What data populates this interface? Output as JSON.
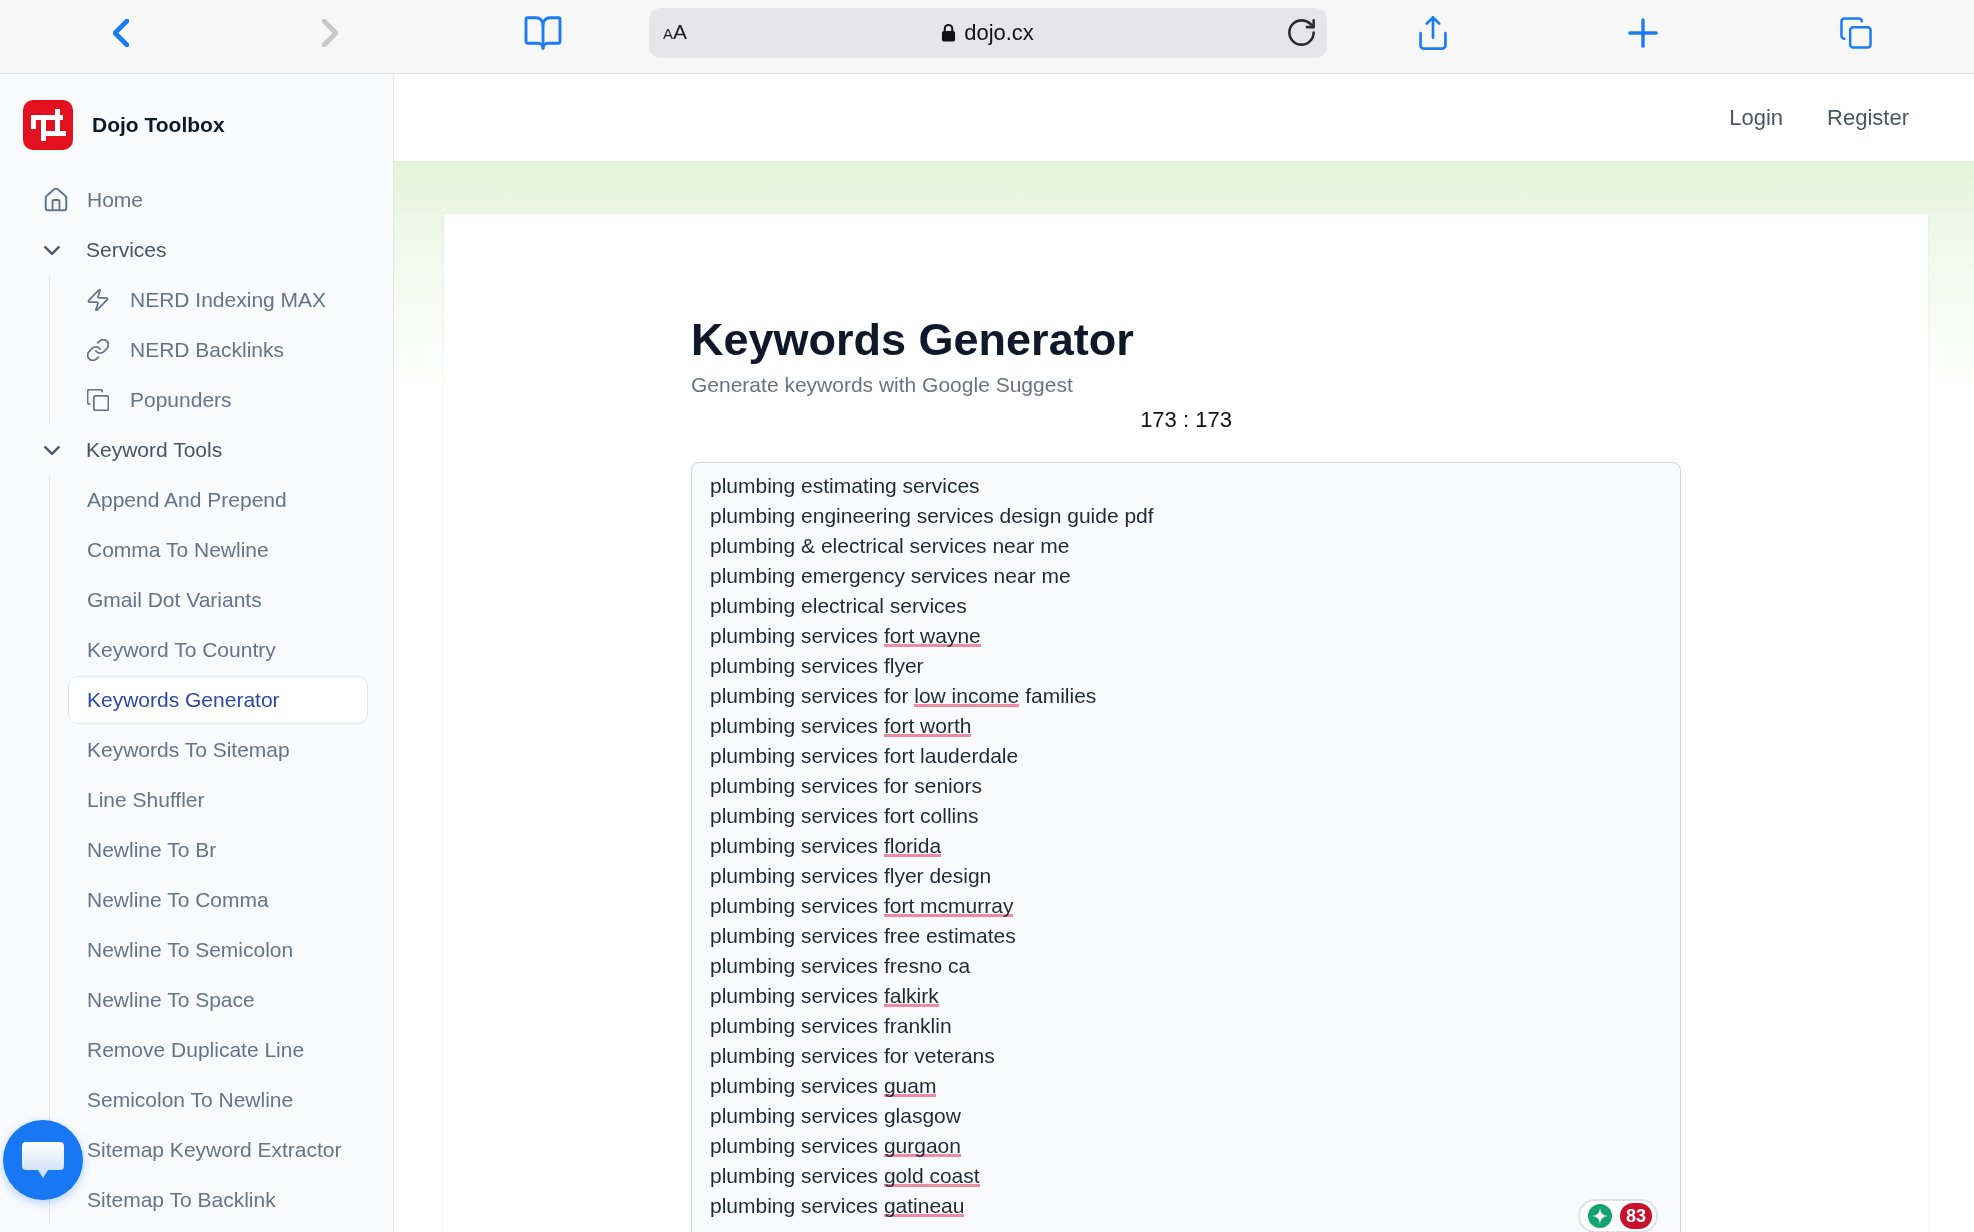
{
  "browser": {
    "back": {
      "disabled": false
    },
    "forward": {
      "disabled": true
    },
    "address": {
      "text_size": "AA",
      "url": "dojo.cx"
    }
  },
  "sidebar": {
    "brand": "Dojo Toolbox",
    "home": {
      "label": "Home",
      "selected": false
    },
    "groups": [
      {
        "label": "Services",
        "expanded": true,
        "items": [
          {
            "label": "NERD Indexing MAX",
            "selected": false
          },
          {
            "label": "NERD Backlinks",
            "selected": false
          },
          {
            "label": "Popunders",
            "selected": false
          }
        ]
      },
      {
        "label": "Keyword Tools",
        "expanded": true,
        "items": [
          {
            "label": "Append And Prepend",
            "selected": false
          },
          {
            "label": "Comma To Newline",
            "selected": false
          },
          {
            "label": "Gmail Dot Variants",
            "selected": false
          },
          {
            "label": "Keyword To Country",
            "selected": false
          },
          {
            "label": "Keywords Generator",
            "selected": true
          },
          {
            "label": "Keywords To Sitemap",
            "selected": false
          },
          {
            "label": "Line Shuffler",
            "selected": false
          },
          {
            "label": "Newline To Br",
            "selected": false
          },
          {
            "label": "Newline To Comma",
            "selected": false
          },
          {
            "label": "Newline To Semicolon",
            "selected": false
          },
          {
            "label": "Newline To Space",
            "selected": false
          },
          {
            "label": "Remove Duplicate Line",
            "selected": false
          },
          {
            "label": "Semicolon To Newline",
            "selected": false
          },
          {
            "label": "Sitemap Keyword Extractor",
            "selected": false
          },
          {
            "label": "Sitemap To Backlink",
            "selected": false
          }
        ]
      }
    ]
  },
  "header": {
    "links": [
      "Login",
      "Register"
    ]
  },
  "tool": {
    "title": "Keywords Generator",
    "subtitle": "Generate keywords with Google Suggest",
    "counter": "173 : 173",
    "keywords": [
      {
        "segments": [
          {
            "text": "plumbing estimating services",
            "flagged": false
          }
        ]
      },
      {
        "segments": [
          {
            "text": "plumbing engineering services design guide pdf",
            "flagged": false
          }
        ]
      },
      {
        "segments": [
          {
            "text": "plumbing & electrical services near me",
            "flagged": false
          }
        ]
      },
      {
        "segments": [
          {
            "text": "plumbing emergency services near me",
            "flagged": false
          }
        ]
      },
      {
        "segments": [
          {
            "text": "plumbing electrical services",
            "flagged": false
          }
        ]
      },
      {
        "segments": [
          {
            "text": "plumbing services ",
            "flagged": false
          },
          {
            "text": "fort wayne",
            "flagged": true
          }
        ]
      },
      {
        "segments": [
          {
            "text": "plumbing services flyer",
            "flagged": false
          }
        ]
      },
      {
        "segments": [
          {
            "text": "plumbing services for ",
            "flagged": false
          },
          {
            "text": "low income",
            "flagged": true
          },
          {
            "text": " families",
            "flagged": false
          }
        ]
      },
      {
        "segments": [
          {
            "text": "plumbing services ",
            "flagged": false
          },
          {
            "text": "fort worth",
            "flagged": true
          }
        ]
      },
      {
        "segments": [
          {
            "text": "plumbing services fort lauderdale",
            "flagged": false
          }
        ]
      },
      {
        "segments": [
          {
            "text": "plumbing services for seniors",
            "flagged": false
          }
        ]
      },
      {
        "segments": [
          {
            "text": "plumbing services fort collins",
            "flagged": false
          }
        ]
      },
      {
        "segments": [
          {
            "text": "plumbing services ",
            "flagged": false
          },
          {
            "text": "florida",
            "flagged": true
          }
        ]
      },
      {
        "segments": [
          {
            "text": "plumbing services flyer design",
            "flagged": false
          }
        ]
      },
      {
        "segments": [
          {
            "text": "plumbing services ",
            "flagged": false
          },
          {
            "text": "fort mcmurray",
            "flagged": true
          }
        ]
      },
      {
        "segments": [
          {
            "text": "plumbing services free estimates",
            "flagged": false
          }
        ]
      },
      {
        "segments": [
          {
            "text": "plumbing services fresno ca",
            "flagged": false
          }
        ]
      },
      {
        "segments": [
          {
            "text": "plumbing services ",
            "flagged": false
          },
          {
            "text": "falkirk",
            "flagged": true
          }
        ]
      },
      {
        "segments": [
          {
            "text": "plumbing services franklin",
            "flagged": false
          }
        ]
      },
      {
        "segments": [
          {
            "text": "plumbing services for veterans",
            "flagged": false
          }
        ]
      },
      {
        "segments": [
          {
            "text": "plumbing services ",
            "flagged": false
          },
          {
            "text": "guam",
            "flagged": true
          }
        ]
      },
      {
        "segments": [
          {
            "text": "plumbing services glasgow",
            "flagged": false
          }
        ]
      },
      {
        "segments": [
          {
            "text": "plumbing services ",
            "flagged": false
          },
          {
            "text": "gurgaon",
            "flagged": true
          }
        ]
      },
      {
        "segments": [
          {
            "text": "plumbing services ",
            "flagged": false
          },
          {
            "text": "gold coast",
            "flagged": true
          }
        ]
      },
      {
        "segments": [
          {
            "text": "plumbing services ",
            "flagged": false
          },
          {
            "text": "gatineau",
            "flagged": true
          }
        ]
      }
    ],
    "checker_badge": {
      "count": "83"
    }
  }
}
